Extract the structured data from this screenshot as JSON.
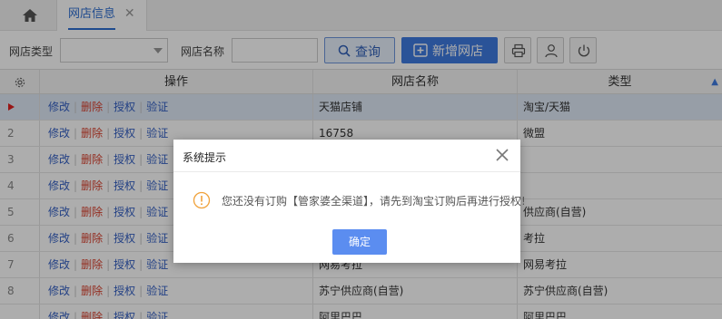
{
  "tabs": {
    "active_label": "网店信息"
  },
  "filter": {
    "type_label": "网店类型",
    "type_value": "",
    "name_label": "网店名称",
    "name_value": "",
    "search_label": "查询",
    "add_label": "新增网店"
  },
  "table": {
    "columns": [
      "操作",
      "网店名称",
      "类型"
    ],
    "sort_column": "类型",
    "action_labels": [
      "修改",
      "删除",
      "授权",
      "验证"
    ],
    "rows": [
      {
        "num": "",
        "selected": true,
        "name": "天猫店铺",
        "type": "淘宝/天猫"
      },
      {
        "num": "2",
        "name": "16758",
        "type": "微盟"
      },
      {
        "num": "3",
        "name": "",
        "type": ""
      },
      {
        "num": "4",
        "name": "",
        "type": ""
      },
      {
        "num": "5",
        "name": "",
        "type": "供应商(自营)"
      },
      {
        "num": "6",
        "name": "",
        "type": "考拉"
      },
      {
        "num": "7",
        "name": "网易考拉",
        "type": "网易考拉"
      },
      {
        "num": "8",
        "name": "苏宁供应商(自营)",
        "type": "苏宁供应商(自营)"
      },
      {
        "num": "",
        "name": "阿里巴巴",
        "type": "阿里巴巴"
      }
    ]
  },
  "dialog": {
    "title": "系统提示",
    "message": "您还没有订购【管家婆全渠道】，请先到淘宝订购后再进行授权!",
    "ok_label": "确定"
  },
  "colors": {
    "accent": "#3f7be0",
    "link": "#3561c4",
    "danger": "#d9412f",
    "warning_icon": "#f0a23b"
  }
}
